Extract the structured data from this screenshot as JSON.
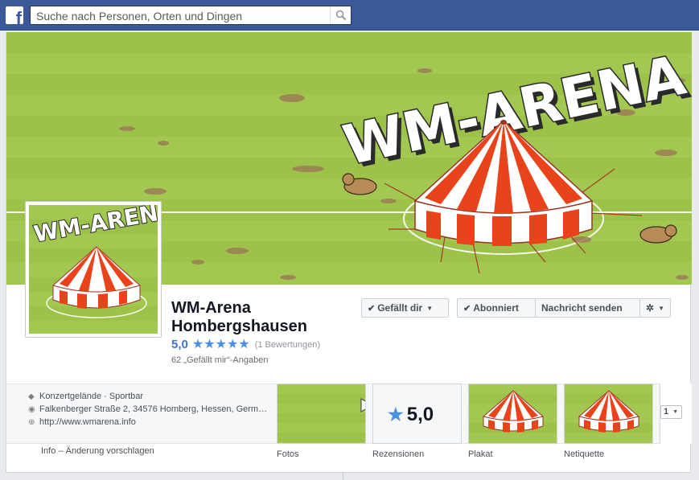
{
  "topbar": {
    "logo": "f",
    "search_placeholder": "Suche nach Personen, Orten und Dingen",
    "search_icon": "magnifier-icon"
  },
  "cover": {
    "title": "WM-ARENA"
  },
  "profile": {
    "logo_text": "WM-ARENA",
    "name_line1": "WM-Arena",
    "name_line2": "Hombergshausen",
    "rating": "5,0",
    "stars": 5,
    "rating_count": "(1 Bewertungen)",
    "likes": "62 „Gefällt mir“-Angaben"
  },
  "actions": {
    "like_label": "Gefällt dir",
    "subscribed_label": "Abonniert",
    "message_label": "Nachricht senden"
  },
  "info": {
    "category": "Konzertgelände · Sportbar",
    "address": "Falkenberger Straße 2, 34576 Homberg, Hessen, Germ…",
    "website": "http://www.wmarena.info",
    "info_link": "Info",
    "suggest_link": "Änderung vorschlagen"
  },
  "tiles": {
    "photos": "Fotos",
    "reviews_value": "5,0",
    "reviews": "Rezensionen",
    "poster": "Plakat",
    "netiquette": "Netiquette",
    "more_select": "1"
  },
  "colors": {
    "brand": "#3b5998",
    "grass": "#9fc54c",
    "tent_red": "#e8431b",
    "star_blue": "#4a90e2"
  }
}
